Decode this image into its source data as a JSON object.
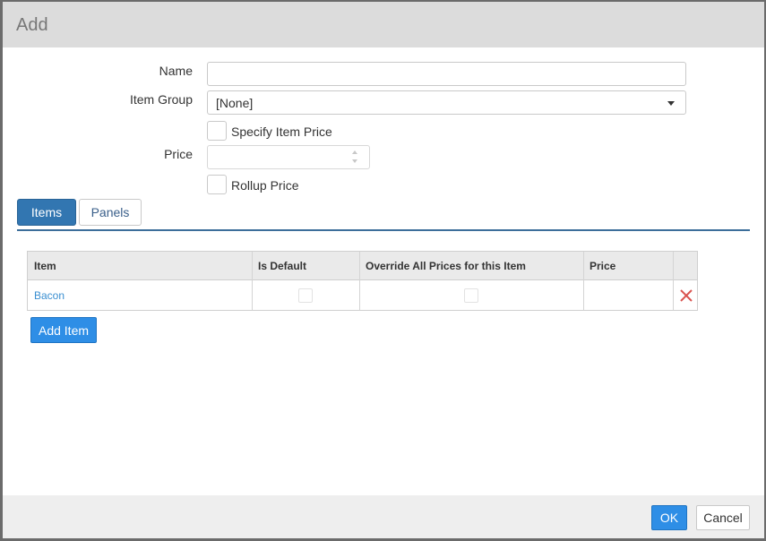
{
  "dialog": {
    "title": "Add"
  },
  "form": {
    "name_label": "Name",
    "name_value": "",
    "item_group_label": "Item Group",
    "item_group_value": "[None]",
    "specify_price_label": "Specify Item Price",
    "specify_price_checked": false,
    "price_label": "Price",
    "price_value": "",
    "rollup_price_label": "Rollup Price",
    "rollup_price_checked": false
  },
  "tabs": [
    {
      "label": "Items",
      "active": true
    },
    {
      "label": "Panels",
      "active": false
    }
  ],
  "grid": {
    "columns": [
      "Item",
      "Is Default",
      "Override All Prices for this Item",
      "Price",
      ""
    ],
    "rows": [
      {
        "item": "Bacon",
        "is_default": false,
        "override_all_prices": false,
        "price": ""
      }
    ],
    "add_item_label": "Add Item"
  },
  "footer": {
    "ok_label": "OK",
    "cancel_label": "Cancel"
  },
  "colors": {
    "primary_button": "#2e8ee6",
    "active_tab": "#3276b1",
    "link": "#3a8fd1",
    "delete_icon": "#d9534f",
    "header_bg": "#dcdcdc"
  }
}
